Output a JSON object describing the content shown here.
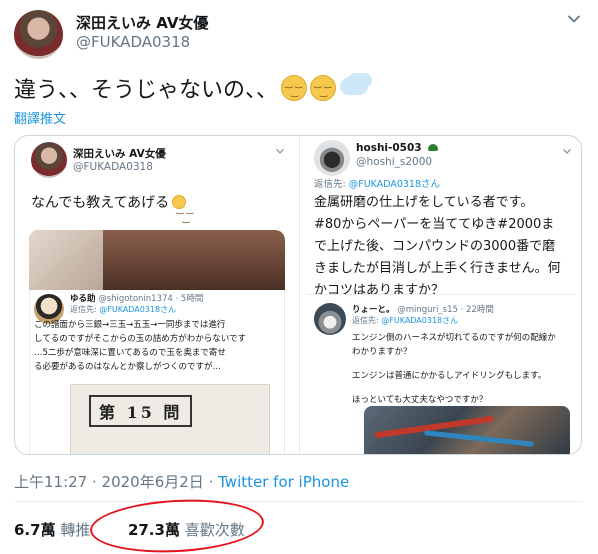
{
  "author": {
    "name": "深田えいみ AV女優",
    "handle": "@FUKADA0318"
  },
  "tweet": {
    "text": "違う、、そうじゃないの、、",
    "emojis": [
      "relieved-face",
      "relieved-face",
      "thought-balloon"
    ],
    "translate_label": "翻譯推文"
  },
  "quoted_left": {
    "name": "深田えいみ AV女優",
    "handle": "@FUKADA0318",
    "text": "なんでも教えてあげる",
    "reply": {
      "name": "ゆる助",
      "handle": "@shigotonin1374",
      "time": "5時間",
      "reply_to_prefix": "返信先: ",
      "reply_to_mention": "@FUKADA0318さん",
      "lines": [
        "この譜面から三銀→三玉→五玉→一同歩までは進行",
        "してるのですがそこからの玉の詰め方がわからないです",
        "…5二歩が意味深に置いてあるので玉を奥まで寄せ",
        "る必要があるのはなんとか察しがつくのですが…"
      ],
      "paper_label": "第 15 問"
    }
  },
  "quoted_right": {
    "name": "hoshi-0503",
    "handle": "@hoshi_s2000",
    "reply_to_prefix": "返信先: ",
    "reply_to_mention": "@FUKADA0318さん",
    "lines": [
      "金属研磨の仕上げをしている者です。",
      "#80からペーパーを当ててゆき#2000ま",
      "で上げた後、コンパウンドの3000番で磨",
      "きましたが目消しが上手く行きません。何",
      "かコツはありますか？"
    ],
    "reply": {
      "name": "りょーと。",
      "handle": "@minguri_s15",
      "time": "22時間",
      "reply_to_prefix": "返信先: ",
      "reply_to_mention": "@FUKADA0318さん",
      "lines": [
        "エンジン側のハーネスが切れてるのですが何の配線か",
        "わかりますか？",
        "",
        "エンジンは普通にかかるしアイドリングもします。",
        "",
        "ほっといても大丈夫なやつですか？"
      ]
    }
  },
  "meta": {
    "time": "上午11:27",
    "separator": " · ",
    "date": "2020年6月2日",
    "client": "Twitter for iPhone"
  },
  "stats": {
    "retweets_count": "6.7萬",
    "retweets_label": "轉推",
    "likes_count": "27.3萬",
    "likes_label": "喜歡次數"
  },
  "colors": {
    "link": "#1b95e0",
    "secondary": "#657786",
    "highlight_circle": "#e3141e"
  }
}
